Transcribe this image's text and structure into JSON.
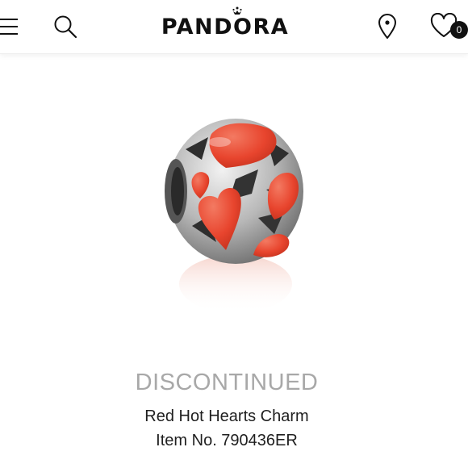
{
  "header": {
    "brand_name": "PANDORA",
    "icons": {
      "menu": "hamburger-menu-icon",
      "search": "search-icon",
      "location": "location-pin-icon",
      "wishlist": "heart-icon"
    },
    "wishlist_count": "0"
  },
  "product": {
    "image": "red-hot-hearts-charm-photo",
    "status": "DISCONTINUED",
    "name": "Red Hot Hearts Charm",
    "item_number": "Item No. 790436ER"
  },
  "colors": {
    "enamel_red": "#e8452e",
    "silver": "#c9c9c9",
    "status_gray": "#a8a8a8",
    "text_dark": "#1f1f1f"
  }
}
